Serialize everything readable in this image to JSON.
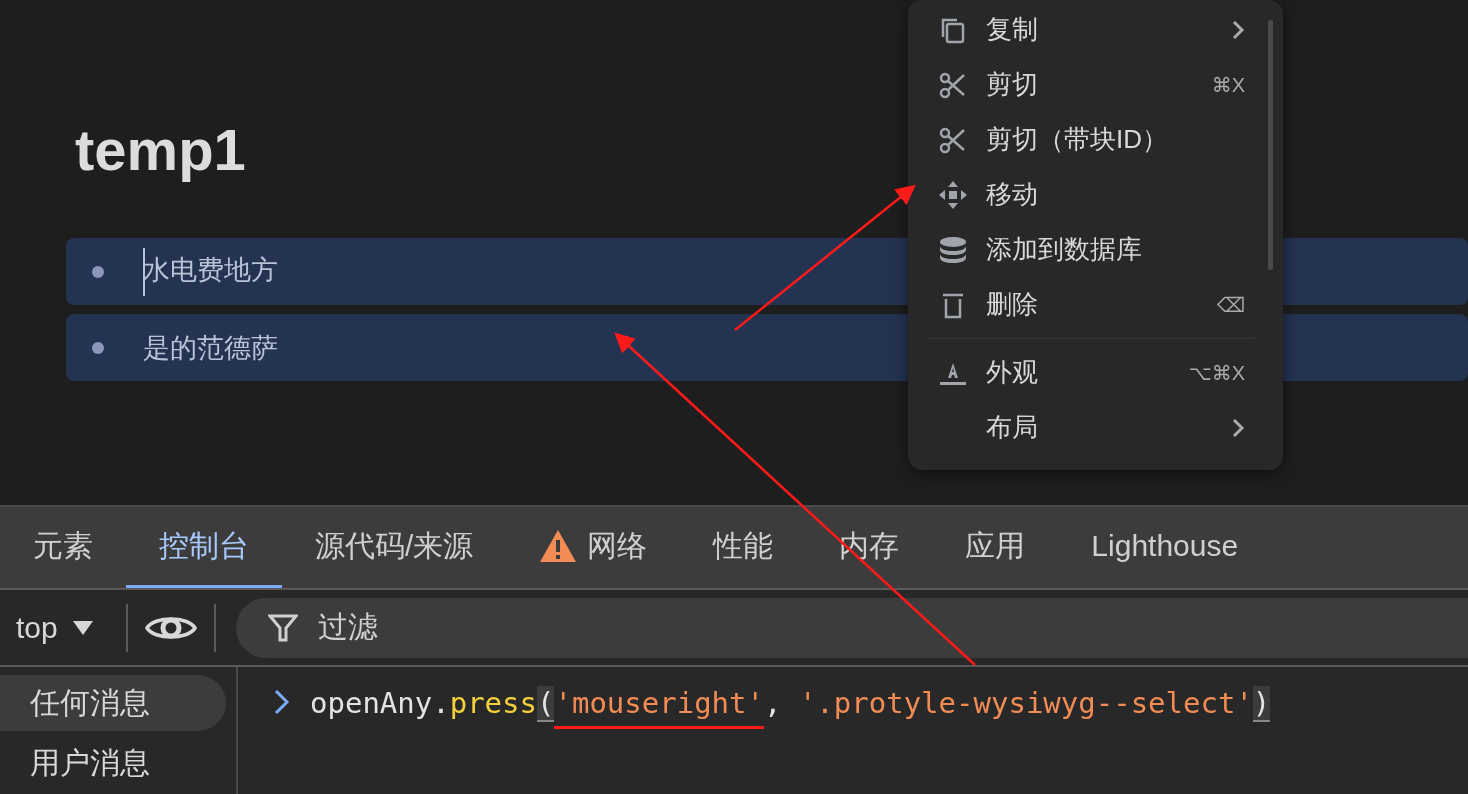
{
  "editor": {
    "title": "temp1",
    "blocks": [
      {
        "text": "水电费地方",
        "selected": true,
        "caret": true
      },
      {
        "text": "是的范德萨",
        "selected": true,
        "caret": false
      }
    ]
  },
  "context_menu": {
    "items": [
      {
        "kind": "item",
        "label": "复制",
        "submenu": true
      },
      {
        "kind": "item",
        "label": "剪切",
        "shortcut": "⌘X",
        "submenu": false
      },
      {
        "kind": "item",
        "label": "剪切（带块ID）",
        "submenu": false
      },
      {
        "kind": "item",
        "label": "移动",
        "submenu": false
      },
      {
        "kind": "item",
        "label": "添加到数据库",
        "submenu": false
      },
      {
        "kind": "item",
        "label": "删除",
        "shortcut": "⌫",
        "submenu": false
      },
      {
        "kind": "separator"
      },
      {
        "kind": "item",
        "label": "外观",
        "shortcut": "⌥⌘X",
        "submenu": false
      },
      {
        "kind": "item",
        "label": "布局",
        "submenu": true
      }
    ]
  },
  "devtools": {
    "tabs": [
      {
        "label": "元素",
        "selected": false,
        "warning": false
      },
      {
        "label": "控制台",
        "selected": true,
        "warning": false
      },
      {
        "label": "源代码/来源",
        "selected": false,
        "warning": false
      },
      {
        "label": "网络",
        "selected": false,
        "warning": true
      },
      {
        "label": "性能",
        "selected": false,
        "warning": false
      },
      {
        "label": "内存",
        "selected": false,
        "warning": false
      },
      {
        "label": "应用",
        "selected": false,
        "warning": false
      },
      {
        "label": "Lighthouse",
        "selected": false,
        "warning": false
      }
    ],
    "context_selector": "top",
    "filter": {
      "placeholder": "过滤"
    },
    "sidebar": [
      {
        "label": "任何消息",
        "selected": true
      },
      {
        "label": "用户消息",
        "selected": false
      }
    ],
    "console_input": [
      {
        "kind": "plain",
        "text": "openAny."
      },
      {
        "kind": "method",
        "text": "press"
      },
      {
        "kind": "paren",
        "text": "("
      },
      {
        "kind": "string",
        "text": "'mouseright'",
        "underlined": true
      },
      {
        "kind": "plain",
        "text": ", "
      },
      {
        "kind": "string",
        "text": "'.protyle-wysiwyg--select'"
      },
      {
        "kind": "paren",
        "text": ")"
      }
    ]
  }
}
